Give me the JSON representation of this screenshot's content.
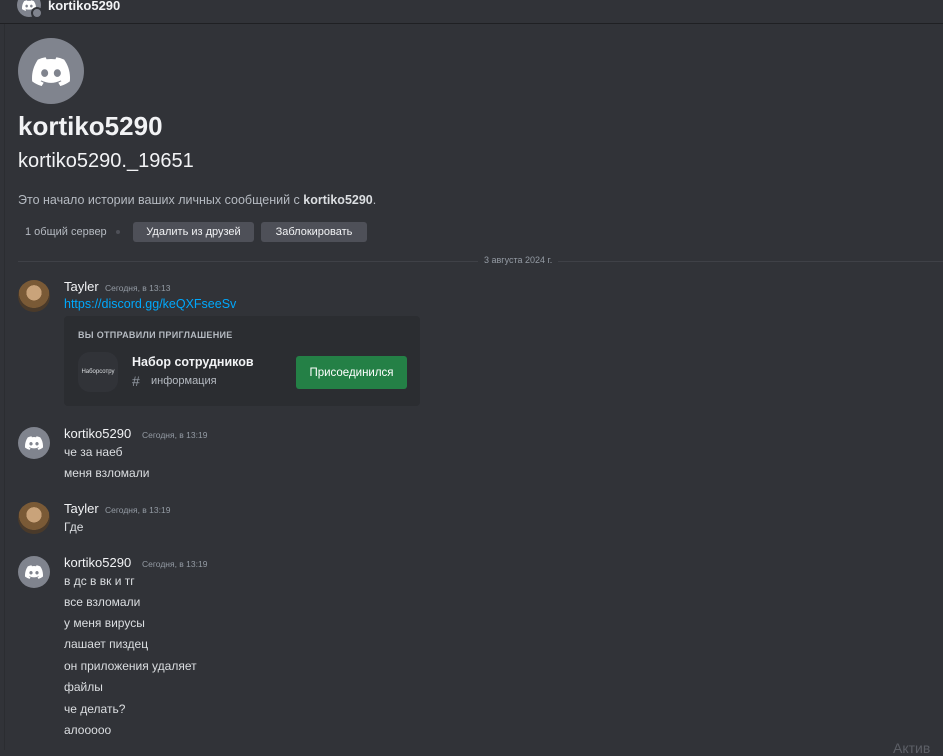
{
  "topbar": {
    "username": "kortiko5290"
  },
  "profile": {
    "display_name": "kortiko5290",
    "username": "kortiko5290._19651",
    "intro_prefix": "Это начало истории ваших личных сообщений с ",
    "intro_name": "kortiko5290",
    "intro_suffix": ".",
    "mutual_servers": "1 общий сервер",
    "remove_friend_label": "Удалить из друзей",
    "block_label": "Заблокировать"
  },
  "date_divider": "3 августа 2024 г.",
  "messages": [
    {
      "author": "Tayler",
      "timestamp": "Сегодня, в 13:13",
      "link": "https://discord.gg/keQXFseeSv",
      "invite": {
        "header": "ВЫ ОТПРАВИЛИ ПРИГЛАШЕНИЕ",
        "guild_icon_text": "Наборсотру",
        "guild_name": "Набор сотрудников",
        "channel": "информация",
        "button_label": "Присоединился"
      }
    },
    {
      "author": "kortiko5290",
      "timestamp": "Сегодня, в 13:19",
      "lines": [
        "че за наеб",
        "меня взломали"
      ]
    },
    {
      "author": "Tayler",
      "timestamp": "Сегодня, в 13:19",
      "lines": [
        "Где"
      ]
    },
    {
      "author": "kortiko5290",
      "timestamp": "Сегодня, в 13:19",
      "lines": [
        "в дс в вк и тг",
        "все взломали",
        "у меня вирусы",
        "лашает пиздец",
        "он приложения удаляет",
        "файлы",
        "че делать?",
        "алооооо"
      ]
    }
  ],
  "watermark": "Актив",
  "icons": {
    "discord": "discord-logo-icon",
    "status": "offline-status-icon",
    "hash": "channel-hash-icon"
  },
  "colors": {
    "background": "#313338",
    "link": "#00a8fc",
    "join_button": "#248046"
  }
}
